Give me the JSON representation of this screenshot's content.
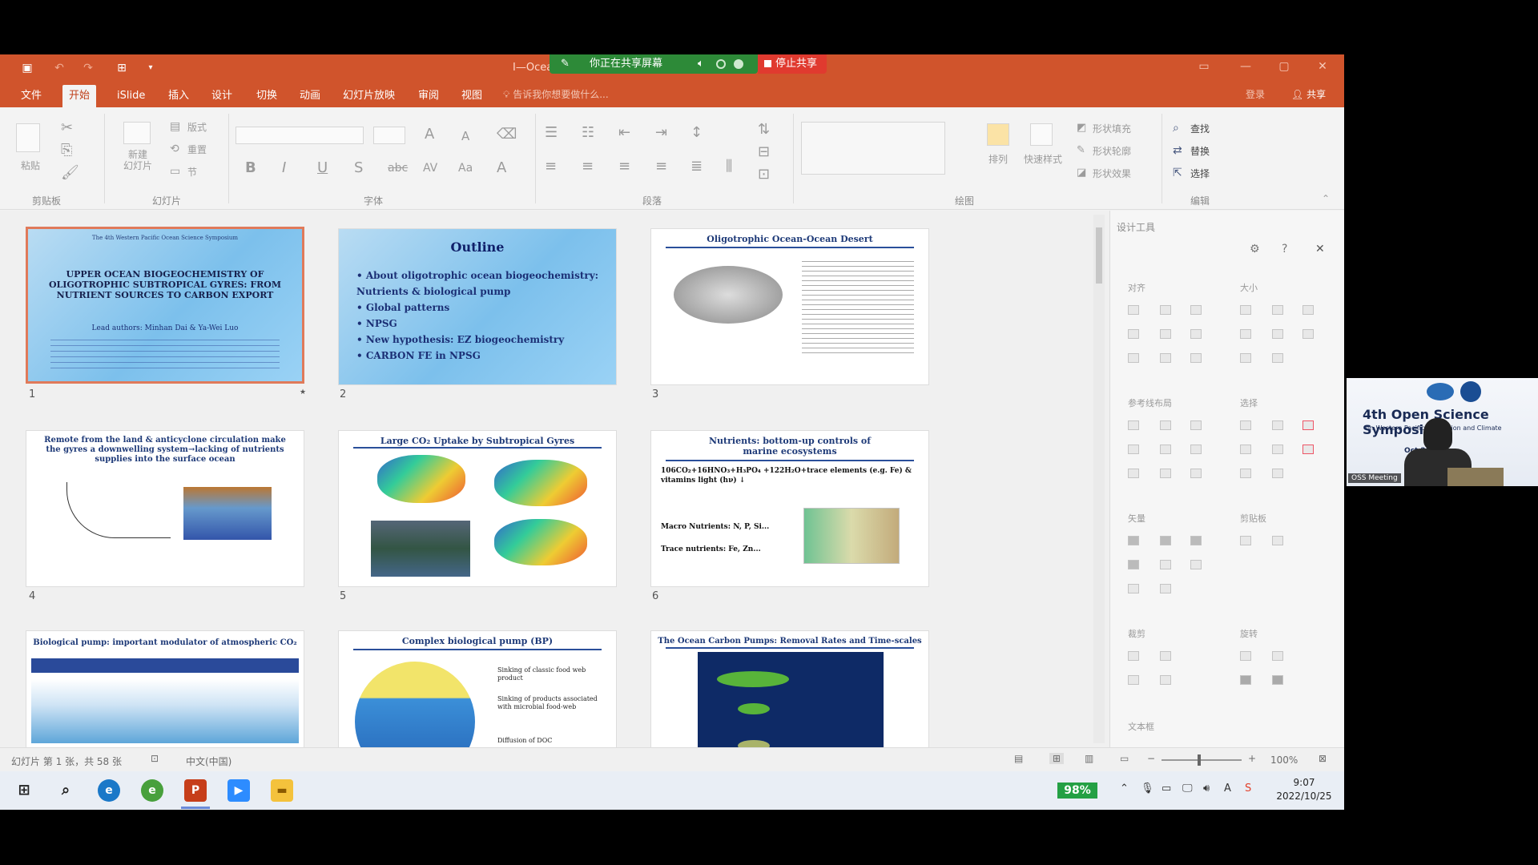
{
  "titlebar": {
    "doc_title": "I—Ocean",
    "share_status": "你正在共享屏幕",
    "stop_share": "停止共享"
  },
  "menu": {
    "tabs": [
      "文件",
      "开始",
      "iSlide",
      "插入",
      "设计",
      "切换",
      "动画",
      "幻灯片放映",
      "审阅",
      "视图"
    ],
    "active_tab": "开始",
    "tell_me": "告诉我你想要做什么...",
    "login": "登录",
    "share": "共享"
  },
  "ribbon": {
    "groups": [
      "剪贴板",
      "幻灯片",
      "字体",
      "段落",
      "绘图",
      "编辑"
    ],
    "paste": "粘贴",
    "new_slide": "新建\n幻灯片",
    "layout": "版式",
    "reset": "重置",
    "section": "节",
    "arrange": "排列",
    "quick_styles": "快速样式",
    "shape_fill": "形状填充",
    "shape_outline": "形状轮廓",
    "shape_effects": "形状效果",
    "find": "查找",
    "replace": "替换",
    "select": "选择"
  },
  "slides": [
    {
      "num": "1",
      "header": "The 4th Western Pacific Ocean Science Symposium",
      "title": "UPPER OCEAN BIOGEOCHEMISTRY OF OLIGOTROPHIC SUBTROPICAL GYRES: FROM NUTRIENT SOURCES TO CARBON EXPORT",
      "authors": "Lead authors: Minhan Dai & Ya-Wei Luo"
    },
    {
      "num": "2",
      "title": "Outline",
      "items": [
        "About oligotrophic ocean biogeochemistry: Nutrients & biological pump",
        "Global patterns",
        "NPSG",
        "New hypothesis: EZ biogeochemistry",
        "CARBON FE in NPSG"
      ]
    },
    {
      "num": "3",
      "title": "Oligotrophic Ocean-Ocean Desert"
    },
    {
      "num": "4",
      "title": "Remote from the land & anticyclone circulation make the gyres a downwelling system→lacking of nutrients supplies into the surface ocean"
    },
    {
      "num": "5",
      "title": "Large CO₂ Uptake by Subtropical Gyres"
    },
    {
      "num": "6",
      "title": "Nutrients: bottom-up controls of marine ecosystems",
      "equation": "106CO₂+16HNO₃+H₃PO₄ +122H₂O+trace elements (e.g. Fe) & vitamins light (hν) ↓",
      "macro": "Macro Nutrients: N, P, Si...",
      "trace": "Trace nutrients: Fe, Zn..."
    },
    {
      "num": "7",
      "title": "Biological pump: important modulator of atmospheric CO₂"
    },
    {
      "num": "8",
      "title": "Complex biological pump (BP)",
      "bullets": [
        "Sinking of classic food web product",
        "Sinking of products associated with microbial food-web",
        "Diffusion of DOC"
      ]
    },
    {
      "num": "9",
      "title": "The Ocean Carbon Pumps: Removal Rates and Time-scales"
    }
  ],
  "panel": {
    "title": "设计工具",
    "sections": [
      "对齐",
      "大小",
      "参考线布局",
      "选择",
      "矢量",
      "剪贴板",
      "裁剪",
      "旋转",
      "文本框"
    ]
  },
  "status": {
    "slide_info": "幻灯片 第 1 张，共 58 张",
    "language": "中文(中国)",
    "zoom": "100%"
  },
  "taskbar": {
    "battery": "98%",
    "time": "9:07",
    "date": "2022/10/25"
  },
  "video": {
    "symposium": "4th Open Science Symposium",
    "sub": "on Western Pacific Circulation and Climate",
    "date": "Oct 2022",
    "name": "OSS Meeting"
  }
}
